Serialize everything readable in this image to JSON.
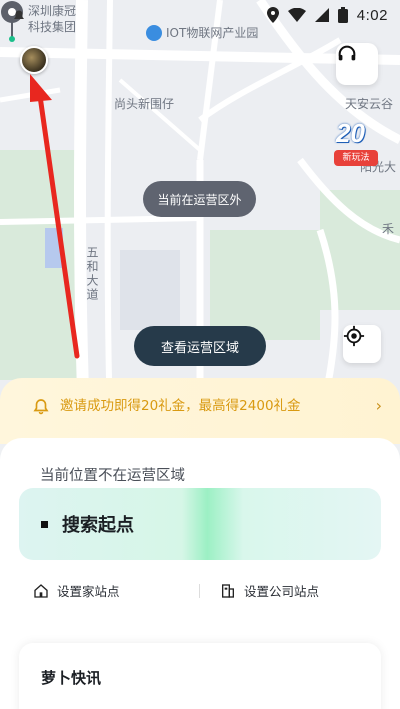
{
  "status_bar": {
    "time": "4:02"
  },
  "map": {
    "poi_labels": {
      "top_left_1": "深圳康冠",
      "top_left_2": "科技集团",
      "iot_park": "IOT物联网产业园",
      "neighborhood": "尚头新围仔",
      "right_tianan": "天安云谷",
      "right_partial_1": "阳光大",
      "right_partial_2": "禾",
      "vertical_road": "五和大道"
    },
    "service_status_pill": "当前在运营区外",
    "view_area_button": "查看运营区域",
    "promo_badge": {
      "number": "20",
      "tag": "新玩法"
    }
  },
  "banner": {
    "text": "邀请成功即得20礼金，最高得2400礼金",
    "chevron": "›"
  },
  "sheet": {
    "location_status": "当前位置不在运营区域",
    "search_label": "搜索起点",
    "home_stop": "设置家站点",
    "company_stop": "设置公司站点",
    "news_title": "萝卜快讯"
  },
  "colors": {
    "accent_red": "#e8413a",
    "banner_text": "#d99a12",
    "dark_pill": "#263a4a",
    "status_pill": "#5f6470"
  },
  "icons": [
    "notification-icon",
    "location-icon",
    "wifi-icon",
    "signal-icon",
    "battery-icon",
    "headset-icon",
    "locate-crosshair-icon",
    "bell-icon",
    "home-icon",
    "building-icon",
    "map-pin-icon"
  ]
}
